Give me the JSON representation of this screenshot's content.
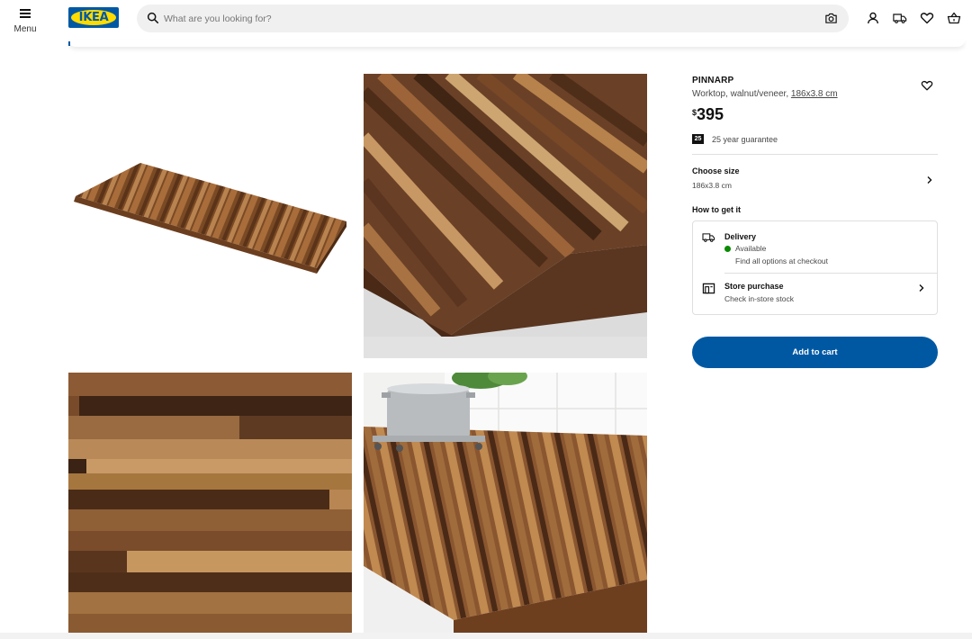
{
  "header": {
    "menu_label": "Menu",
    "logo_text": "IKEA",
    "search_placeholder": "What are you looking for?",
    "icons": [
      "hamburger-icon",
      "search-icon",
      "camera-icon",
      "account-icon",
      "truck-icon",
      "heart-icon",
      "basket-icon"
    ],
    "brand_blue": "#0058a3",
    "brand_yellow": "#ffdb00"
  },
  "gallery": {
    "images": [
      "worktop-product-photo",
      "worktop-corner-closeup",
      "worktop-grain-closeup",
      "worktop-kitchen-scene"
    ]
  },
  "product": {
    "name": "PINNARP",
    "description": "Worktop, walnut/veneer,",
    "size_link": "186x3.8 cm",
    "currency": "$",
    "price": "395",
    "guarantee_badge": "25",
    "guarantee_text": "25 year guarantee",
    "choose_size_label": "Choose size",
    "choose_size_value": "186x3.8 cm",
    "how_to_get_label": "How to get it",
    "delivery": {
      "title": "Delivery",
      "status": "Available",
      "status_color": "#0a8a00",
      "note": "Find all options at checkout"
    },
    "store": {
      "title": "Store purchase",
      "note": "Check in-store stock"
    },
    "add_to_cart_label": "Add to cart"
  }
}
